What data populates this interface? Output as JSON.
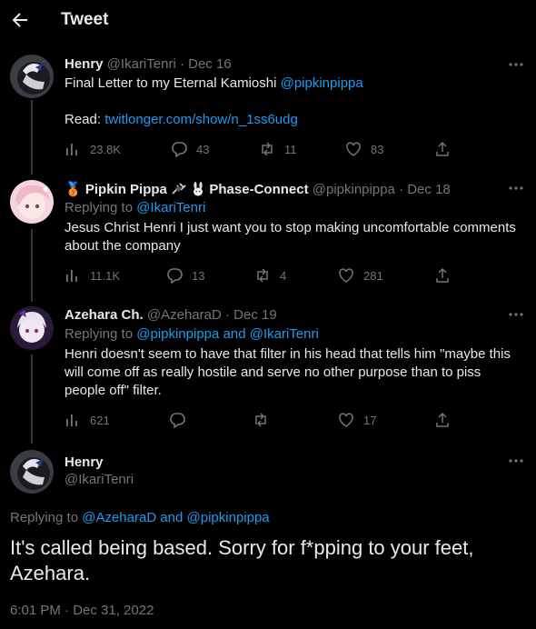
{
  "header": {
    "title": "Tweet"
  },
  "tweets": [
    {
      "name": "Henry",
      "handle": "@IkariTenri",
      "date": "· Dec 16",
      "text": "Final Letter to my Eternal Kamioshi ",
      "mention": "@pipkinpippa",
      "read_label": "Read: ",
      "read_link": "twitlonger.com/show/n_1ss6udg",
      "views": "23.8K",
      "replies": "43",
      "retweets": "11",
      "likes": "83"
    },
    {
      "badge": "🥉",
      "name": "Pipkin Pippa",
      "name_suffix": "Phase-Connect",
      "handle": "@pipkinpippa",
      "date": "· Dec 18",
      "replying_label": "Replying to ",
      "replying_to": "@IkariTenri",
      "text_line1": "Jesus Christ Henri I just want you to stop making uncomfortable comments",
      "text_line2": "about the company",
      "views": "11.1K",
      "replies": "13",
      "retweets": "4",
      "likes": "281"
    },
    {
      "name": "Azehara Ch.",
      "handle": "@AzeharaD",
      "date": "· Dec 19",
      "replying_label": "Replying to ",
      "replying_to_1": "@pipkinpippa",
      "replying_and": " and ",
      "replying_to_2": "@IkariTenri",
      "text_line1": "Henri doesn't seem to have that filter in his head that tells him \"maybe this",
      "text_line2": "will come off as really hostile and serve no other purpose than to piss",
      "text_line3": "people off\" filter.",
      "views": "621",
      "replies": "",
      "retweets": "",
      "likes": "17"
    }
  ],
  "main_tweet": {
    "name": "Henry",
    "handle": "@IkariTenri",
    "replying_label": "Replying to ",
    "replying_to_1": "@AzeharaD",
    "replying_and": " and ",
    "replying_to_2": "@pipkinpippa",
    "text_line1": "It's called being based. Sorry for f*pping to your feet,",
    "text_line2": "Azehara.",
    "timestamp": "6:01 PM · Dec 31, 2022"
  },
  "colors": {
    "link": "#1d9bf0",
    "muted": "#71767b",
    "text": "#e7e9ea",
    "background": "#000000"
  }
}
